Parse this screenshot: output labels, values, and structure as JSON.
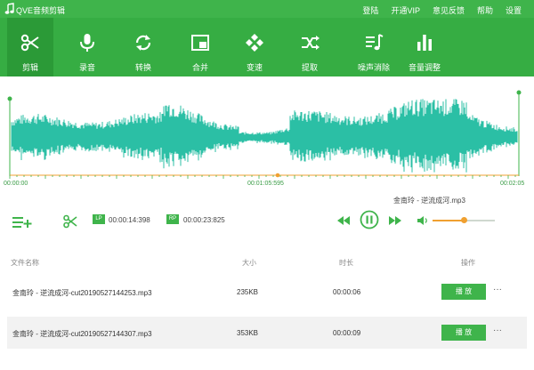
{
  "app": {
    "title": "QVE音频剪辑"
  },
  "menu": {
    "login": "登陆",
    "vip": "开通VIP",
    "feedback": "意见反馈",
    "help": "帮助",
    "settings": "设置"
  },
  "tools": [
    {
      "label": "剪辑",
      "icon": "scissors-icon"
    },
    {
      "label": "录音",
      "icon": "microphone-icon"
    },
    {
      "label": "转换",
      "icon": "convert-icon"
    },
    {
      "label": "合并",
      "icon": "merge-icon"
    },
    {
      "label": "变速",
      "icon": "speed-icon"
    },
    {
      "label": "提取",
      "icon": "extract-icon"
    },
    {
      "label": "噪声消除",
      "icon": "noise-remove-icon"
    },
    {
      "label": "音量调整",
      "icon": "volume-bars-icon"
    }
  ],
  "timeline": {
    "start": "00:00:00",
    "current": "00:01:05:595",
    "end": "00:02:05"
  },
  "player": {
    "now_playing": "金南玲 - 逆流成河.mp3",
    "lp_label": "LP",
    "lp_time": "00:00:14:398",
    "rp_label": "RP",
    "rp_time": "00:00:23:825",
    "volume_level": 0.5
  },
  "table": {
    "headers": {
      "name": "文件名称",
      "size": "大小",
      "duration": "时长",
      "action": "操作"
    },
    "rows": [
      {
        "name": "金南玲 - 逆流成河-cut20190527144253.mp3",
        "size": "235KB",
        "duration": "00:00:06",
        "play": "播 放",
        "more": "···"
      },
      {
        "name": "金南玲 - 逆流成河-cut20190527144307.mp3",
        "size": "353KB",
        "duration": "00:00:09",
        "play": "播 放",
        "more": "···"
      }
    ]
  },
  "colors": {
    "accent": "#3fb44b",
    "wave": "#2bbfa5",
    "marker": "#f0a030"
  }
}
